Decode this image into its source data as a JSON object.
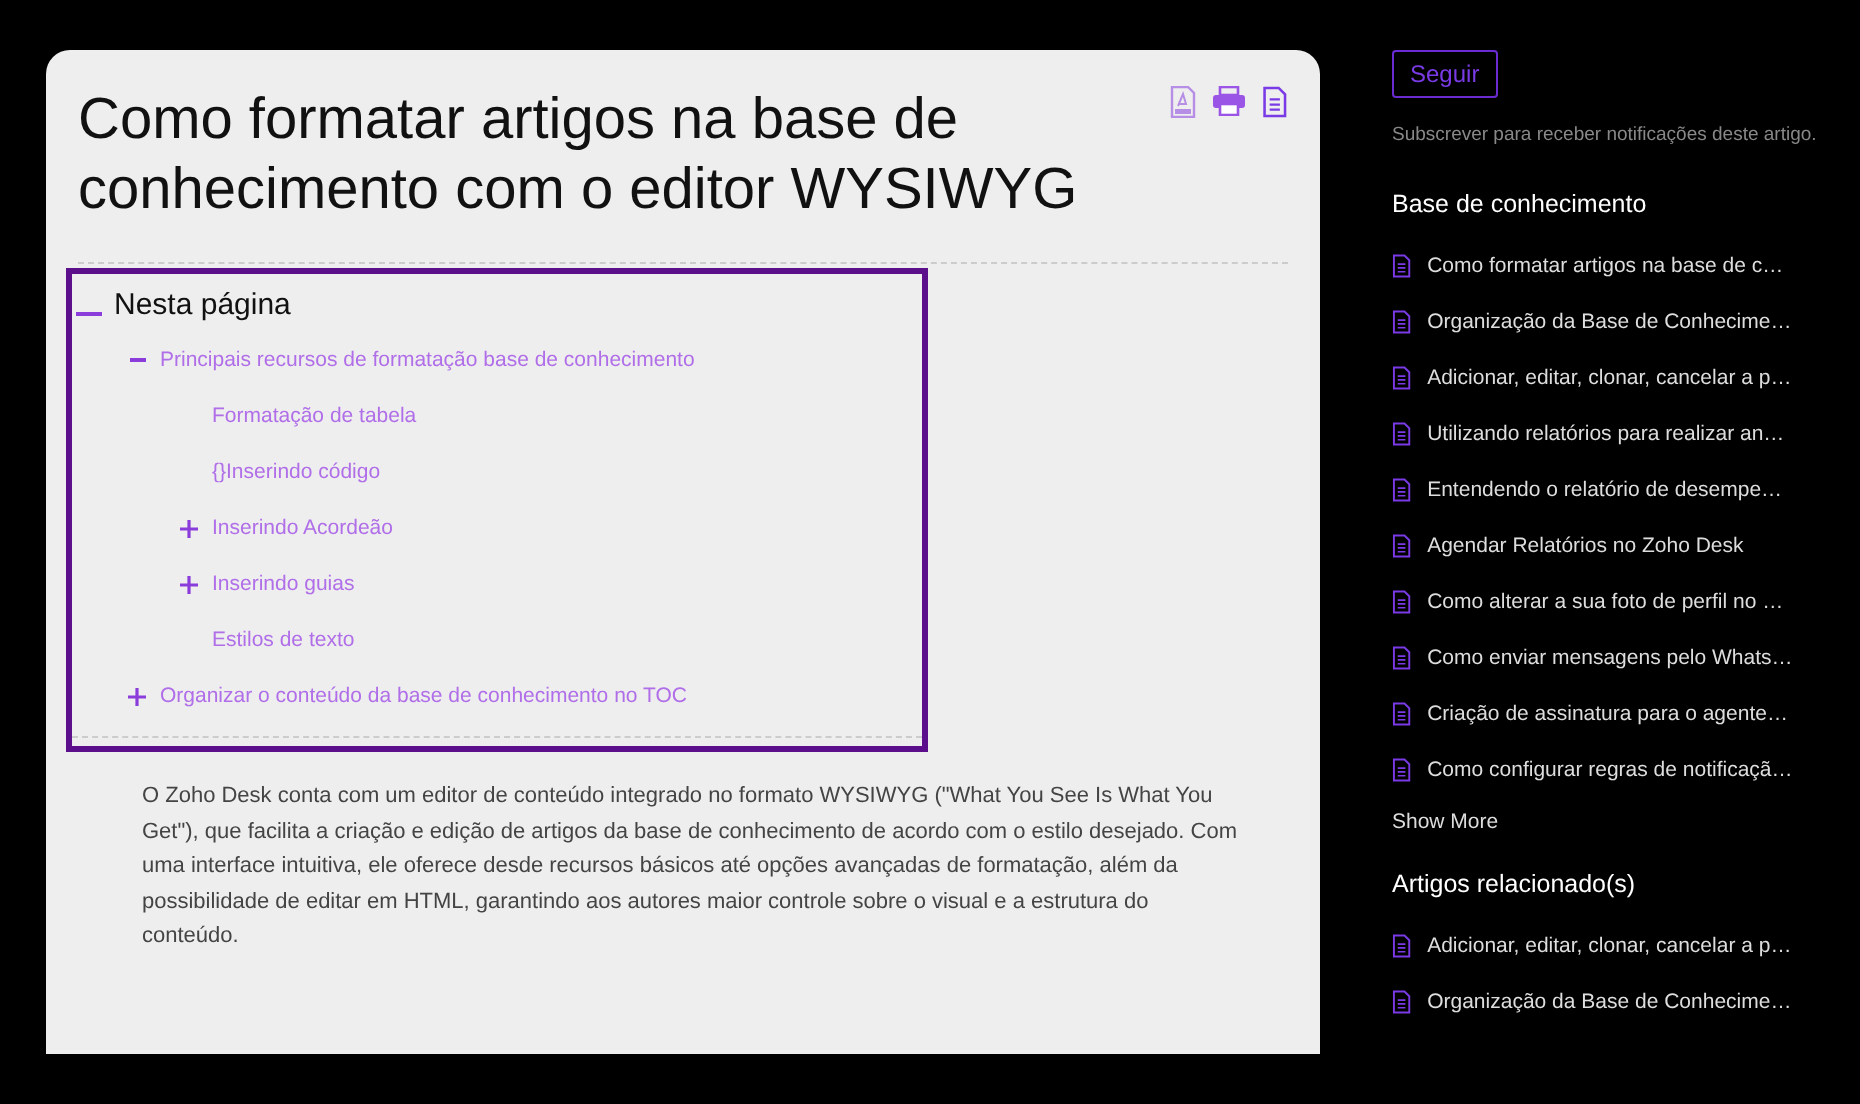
{
  "article": {
    "title": "Como formatar artigos na base de conhecimento com o editor WYSIWYG",
    "toc": {
      "heading": "Nesta página",
      "expanded": true,
      "items": [
        {
          "label": "Principais recursos de formatação base de conhecimento",
          "kind": "group",
          "expanded": true,
          "children": [
            {
              "label": "Formatação de tabela",
              "kind": "leaf"
            },
            {
              "label": "{}Inserindo código",
              "kind": "leaf"
            },
            {
              "label": "Inserindo Acordeão",
              "kind": "group",
              "expanded": false
            },
            {
              "label": "Inserindo guias",
              "kind": "group",
              "expanded": false
            },
            {
              "label": "Estilos de texto",
              "kind": "leaf"
            }
          ]
        },
        {
          "label": "Organizar o conteúdo da base de conhecimento no TOC",
          "kind": "group",
          "expanded": false
        }
      ]
    },
    "body": "O Zoho Desk conta com um editor de conteúdo integrado no formato WYSIWYG (\"What You See Is What You Get\"), que facilita a criação e edição de artigos da base de conhecimento de acordo com o estilo desejado. Com uma interface intuitiva, ele oferece desde recursos básicos até opções avançadas de formatação, além da possibilidade de editar em HTML, garantindo aos autores maior controle sobre o visual e a estrutura do conteúdo."
  },
  "sidebar": {
    "follow_button": "Seguir",
    "follow_hint": "Subscrever para receber notificações deste artigo.",
    "knowledge_base": {
      "heading": "Base de conhecimento",
      "items": [
        "Como formatar artigos na base de c…",
        "Organização da Base de Conhecime…",
        "Adicionar, editar, clonar, cancelar a p…",
        "Utilizando relatórios para realizar an…",
        "Entendendo o relatório de desempe…",
        "Agendar Relatórios no Zoho Desk",
        "Como alterar a sua foto de perfil no …",
        "Como enviar mensagens pelo Whats…",
        "Criação de assinatura para o agente…",
        "Como configurar regras de notificaçã…"
      ],
      "show_more": "Show More"
    },
    "related": {
      "heading": "Artigos relacionado(s)",
      "items": [
        "Adicionar, editar, clonar, cancelar a p…",
        "Organização da Base de Conhecime…"
      ]
    }
  }
}
